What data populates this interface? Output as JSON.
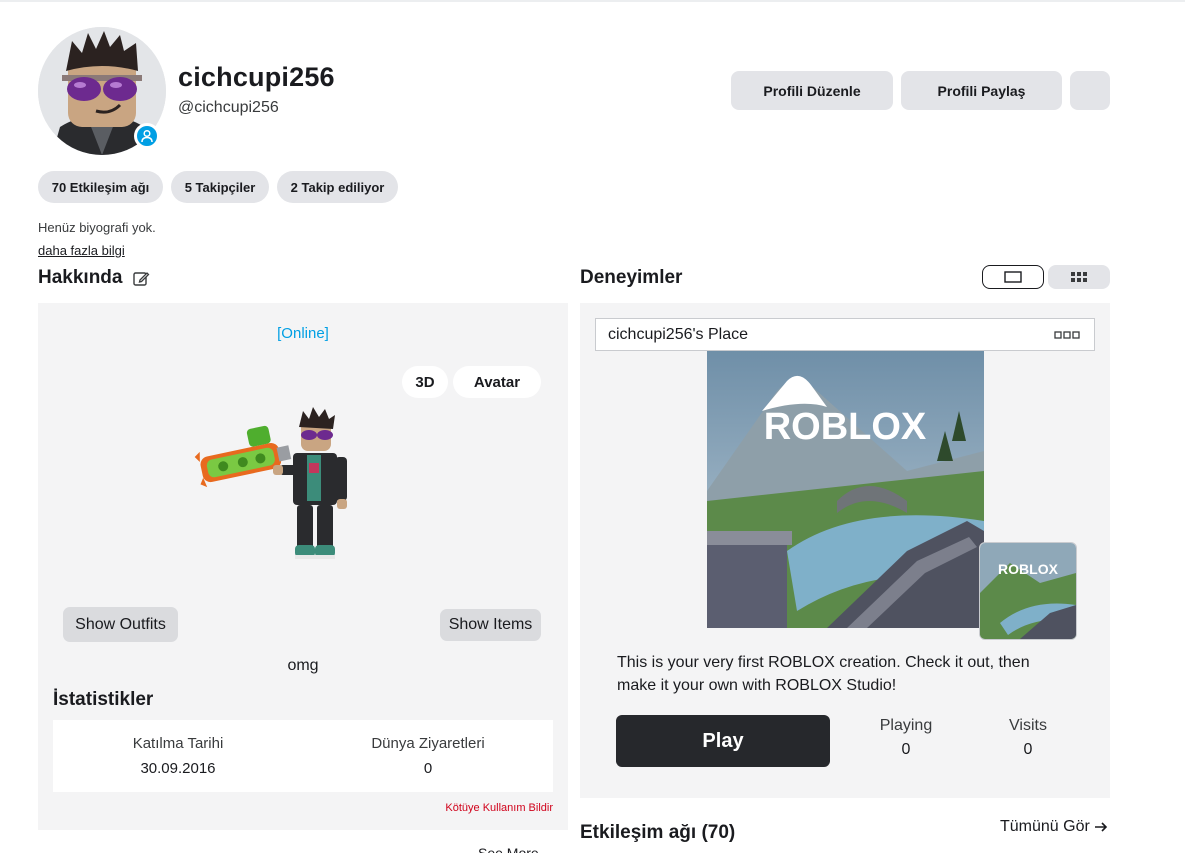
{
  "profile": {
    "display_name": "cichcupi256",
    "username": "@cichcupi256",
    "bio": "Henüz biyografi yok.",
    "more_info": "daha fazla bilgi"
  },
  "actions": {
    "edit_profile": "Profili Düzenle",
    "share_profile": "Profili Paylaş"
  },
  "counts": {
    "connections": "70 Etkileşim ağı",
    "followers": "5 Takipçiler",
    "following": "2 Takip ediliyor"
  },
  "about": {
    "title": "Hakkında",
    "status": "[Online]",
    "toggle_3d": "3D",
    "toggle_avatar": "Avatar",
    "show_outfits": "Show Outfits",
    "show_items": "Show Items",
    "description": "omg",
    "stats_title": "İstatistikler",
    "stats": [
      {
        "label": "Katılma Tarihi",
        "value": "30.09.2016"
      },
      {
        "label": "Dünya Ziyaretleri",
        "value": "0"
      }
    ],
    "report": "Kötüye Kullanım Bildir",
    "see_more": "See More"
  },
  "experiences": {
    "title": "Deneyimler",
    "place_name": "cichcupi256's Place",
    "thumbnail_logo": "ROBLOX",
    "description": "This is your very first ROBLOX creation. Check it out, then make it your own with ROBLOX Studio!",
    "play_label": "Play",
    "playing_label": "Playing",
    "playing_value": "0",
    "visits_label": "Visits",
    "visits_value": "0"
  },
  "connections_section": {
    "title": "Etkileşim ağı (70)",
    "see_all": "Tümünü Gör"
  },
  "colors": {
    "accent_blue": "#009fe4",
    "report_red": "#d0021b",
    "play_button": "#26282c",
    "panel_bg": "#f4f4f5",
    "button_gray": "#e3e4e8"
  }
}
